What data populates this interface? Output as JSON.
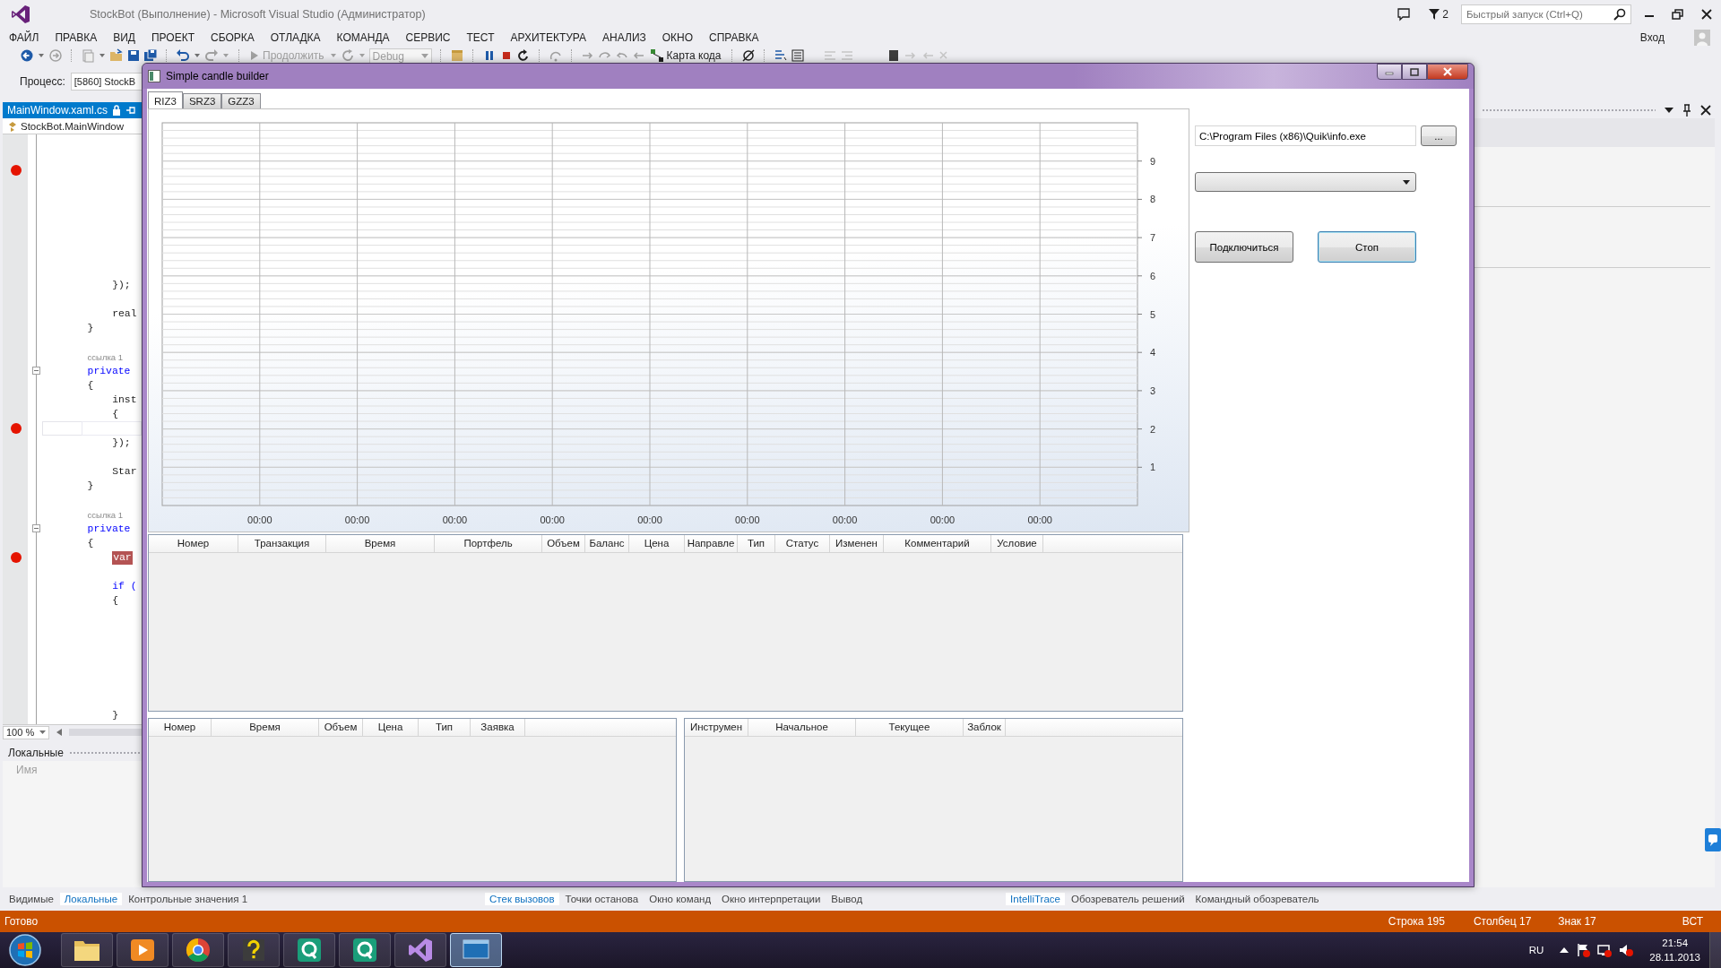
{
  "window": {
    "title": "StockBot (Выполнение) - Microsoft Visual Studio (Администратор)"
  },
  "title_bar": {
    "filter_count": "2",
    "quick_launch": {
      "placeholder": "Быстрый запуск (Ctrl+Q)"
    }
  },
  "menu": {
    "items": [
      "ФАЙЛ",
      "ПРАВКА",
      "ВИД",
      "ПРОЕКТ",
      "СБОРКА",
      "ОТЛАДКА",
      "КОМАНДА",
      "СЕРВИС",
      "ТЕСТ",
      "АРХИТЕКТУРА",
      "АНАЛИЗ",
      "ОКНО",
      "СПРАВКА"
    ],
    "sign_in": "Вход"
  },
  "toolbar": {
    "continue": {
      "label": "Продолжить",
      "disabled": true
    },
    "configuration": {
      "value": "Debug",
      "disabled": true
    },
    "code_map": {
      "label": "Карта кода",
      "disabled": false
    }
  },
  "process": {
    "label": "Процесс:",
    "value": "[5860] StockB"
  },
  "document_tab": {
    "title": "MainWindow.xaml.cs"
  },
  "navigation": {
    "type": "StockBot.MainWindow"
  },
  "code_lines": [
    {
      "kind": "blank",
      "breakpoint": false,
      "current": false
    },
    {
      "kind": "blank",
      "breakpoint": false,
      "current": false
    },
    {
      "kind": "blank",
      "breakpoint": true,
      "current": false
    },
    {
      "kind": "blank",
      "breakpoint": false,
      "current": false
    },
    {
      "kind": "blank",
      "breakpoint": false,
      "current": false
    },
    {
      "kind": "blank",
      "breakpoint": false,
      "current": false
    },
    {
      "kind": "blank",
      "breakpoint": false,
      "current": false
    },
    {
      "kind": "blank",
      "breakpoint": false,
      "current": false
    },
    {
      "kind": "blank",
      "breakpoint": false,
      "current": false
    },
    {
      "kind": "blank",
      "breakpoint": false,
      "current": false
    },
    {
      "kind": "code",
      "text": "        });",
      "breakpoint": false,
      "current": false
    },
    {
      "kind": "blank",
      "breakpoint": false,
      "current": false
    },
    {
      "kind": "code",
      "text": "        real",
      "breakpoint": false,
      "current": false
    },
    {
      "kind": "code",
      "text": "    }",
      "breakpoint": false,
      "current": false
    },
    {
      "kind": "blank",
      "breakpoint": false,
      "current": false
    },
    {
      "kind": "codelens",
      "text": "    ссылка 1",
      "breakpoint": false,
      "current": false
    },
    {
      "kind": "keyword",
      "text": "    private",
      "breakpoint": false,
      "current": false,
      "collapsible": true
    },
    {
      "kind": "code",
      "text": "    {",
      "breakpoint": false,
      "current": false
    },
    {
      "kind": "code",
      "text": "        inst",
      "breakpoint": false,
      "current": false
    },
    {
      "kind": "code",
      "text": "        {",
      "breakpoint": false,
      "current": false
    },
    {
      "kind": "blank",
      "breakpoint": true,
      "current": true
    },
    {
      "kind": "code",
      "text": "        });",
      "breakpoint": false,
      "current": false
    },
    {
      "kind": "blank",
      "breakpoint": false,
      "current": false
    },
    {
      "kind": "code",
      "text": "        Star",
      "breakpoint": false,
      "current": false
    },
    {
      "kind": "code",
      "text": "    }",
      "breakpoint": false,
      "current": false
    },
    {
      "kind": "blank",
      "breakpoint": false,
      "current": false
    },
    {
      "kind": "codelens",
      "text": "    ссылка 1",
      "breakpoint": false,
      "current": false
    },
    {
      "kind": "keyword",
      "text": "    private",
      "breakpoint": false,
      "current": false,
      "collapsible": true
    },
    {
      "kind": "code",
      "text": "    {",
      "breakpoint": false,
      "current": false
    },
    {
      "kind": "keyword",
      "text": "        var",
      "breakpoint": true,
      "current": false
    },
    {
      "kind": "blank",
      "breakpoint": false,
      "current": false
    },
    {
      "kind": "keyword",
      "text": "        if (",
      "breakpoint": false,
      "current": false
    },
    {
      "kind": "code",
      "text": "        {",
      "breakpoint": false,
      "current": false
    },
    {
      "kind": "blank",
      "breakpoint": false,
      "current": false
    },
    {
      "kind": "blank",
      "breakpoint": false,
      "current": false
    },
    {
      "kind": "blank",
      "breakpoint": false,
      "current": false
    },
    {
      "kind": "blank",
      "breakpoint": false,
      "current": false
    },
    {
      "kind": "blank",
      "breakpoint": false,
      "current": false
    },
    {
      "kind": "blank",
      "breakpoint": false,
      "current": false
    },
    {
      "kind": "blank",
      "breakpoint": false,
      "current": false
    },
    {
      "kind": "code",
      "text": "        }",
      "breakpoint": false,
      "current": false
    }
  ],
  "zoom": "100 %",
  "locals_panel": {
    "title": "Локальные",
    "column": "Имя"
  },
  "bottom_tabs": {
    "left": [
      {
        "label": "Видимые",
        "selected": false
      },
      {
        "label": "Локальные",
        "selected": true
      },
      {
        "label": "Контрольные значения 1",
        "selected": false
      }
    ],
    "center": [
      {
        "label": "Стек вызовов",
        "selected": true
      },
      {
        "label": "Точки останова",
        "selected": false
      },
      {
        "label": "Окно команд",
        "selected": false
      },
      {
        "label": "Окно интерпретации",
        "selected": false
      },
      {
        "label": "Вывод",
        "selected": false
      }
    ],
    "right": [
      {
        "label": "IntelliTrace",
        "selected": true
      },
      {
        "label": "Обозреватель решений",
        "selected": false
      },
      {
        "label": "Командный обозреватель",
        "selected": false
      }
    ]
  },
  "status_bar": {
    "text": "Готово",
    "line": "Строка 195",
    "column": "Столбец 17",
    "char": "Знак 17",
    "mode": "ВСТ"
  },
  "taskbar": {
    "apps": [
      {
        "kind": "folder",
        "selected": false
      },
      {
        "kind": "media",
        "selected": false
      },
      {
        "kind": "browser",
        "selected": false
      },
      {
        "kind": "help",
        "selected": false
      },
      {
        "kind": "quik",
        "selected": false
      },
      {
        "kind": "quik",
        "selected": false
      },
      {
        "kind": "studio",
        "selected": false
      },
      {
        "kind": "window",
        "selected": true
      }
    ],
    "language": "RU",
    "time": "21:54",
    "date": "28.11.2013"
  },
  "dialog": {
    "title": "Simple candle builder",
    "tabs": [
      {
        "label": "RIZ3",
        "selected": true
      },
      {
        "label": "SRZ3",
        "selected": false
      },
      {
        "label": "GZZ3",
        "selected": false
      }
    ],
    "chart_data": {
      "type": "line",
      "grid": true,
      "ylim": [
        0,
        10
      ],
      "yticks": [
        1,
        2,
        3,
        4,
        5,
        6,
        7,
        8,
        9
      ],
      "categories": [
        "00:00",
        "00:00",
        "00:00",
        "00:00",
        "00:00",
        "00:00",
        "00:00",
        "00:00",
        "00:00"
      ]
    },
    "path_field": {
      "value": "C:\\Program Files (x86)\\Quik\\info.exe"
    },
    "browse_button": "...",
    "connect_button": "Подключиться",
    "stop_button": {
      "label": "Стоп",
      "focused": true
    },
    "orders_table": {
      "columns": [
        "Номер",
        "Транзакция",
        "Время",
        "Портфель",
        "Объем",
        "Баланс",
        "Цена",
        "Направле",
        "Тип",
        "Статус",
        "Изменен",
        "Комментарий",
        "Условие"
      ]
    },
    "trades_table": {
      "columns": [
        "Номер",
        "Время",
        "Объем",
        "Цена",
        "Тип",
        "Заявка"
      ]
    },
    "positions_table": {
      "columns": [
        "Инструмен",
        "Начальное",
        "Текущее",
        "Заблок"
      ]
    }
  }
}
